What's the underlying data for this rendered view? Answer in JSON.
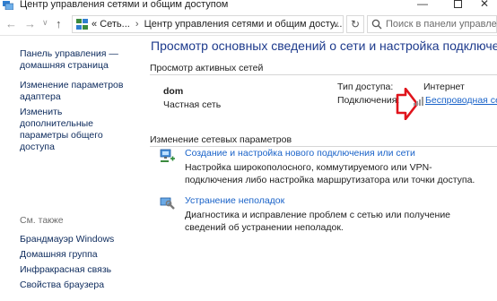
{
  "window": {
    "title": "Центр управления сетями и общим доступом",
    "controls": {
      "minimize": "—",
      "close": "✕"
    }
  },
  "address_bar": {
    "recent_marker": "«",
    "crumbs": [
      "Сеть...",
      "Центр управления сетями и общим досту..."
    ],
    "separator": "›",
    "dropdown": "∨",
    "refresh": "↻",
    "search_placeholder": "Поиск в панели управления"
  },
  "nav": {
    "back": "←",
    "forward": "→",
    "recent": "∨",
    "up": "↑"
  },
  "sidebar": {
    "links": [
      "Панель управления — домашняя страница",
      "Изменение параметров адаптера",
      "Изменить дополнительные параметры общего доступа"
    ],
    "see_also_label": "См. также",
    "see_also": [
      "Брандмауэр Windows",
      "Домашняя группа",
      "Инфракрасная связь",
      "Свойства браузера"
    ]
  },
  "main": {
    "title": "Просмотр основных сведений о сети и настройка подключений",
    "active_networks_header": "Просмотр активных сетей",
    "network": {
      "name": "dom",
      "type": "Частная сеть",
      "access_label": "Тип доступа:",
      "access_value": "Интернет",
      "connections_label": "Подключения:",
      "connection_link": "Беспроводная сеть"
    },
    "change_header": "Изменение сетевых параметров",
    "tasks": [
      {
        "icon": "network-setup-icon",
        "link": "Создание и настройка нового подключения или сети",
        "desc": "Настройка широкополосного, коммутируемого или VPN-подключения либо настройка маршрутизатора или точки доступа."
      },
      {
        "icon": "troubleshoot-icon",
        "link": "Устранение неполадок",
        "desc": "Диагностика и исправление проблем с сетью или получение сведений об устранении неполадок."
      }
    ]
  },
  "colors": {
    "link": "#1a63c9",
    "title": "#1d3a8c",
    "nav_link": "#0c2a5c",
    "annotation_arrow": "#e0141c"
  }
}
